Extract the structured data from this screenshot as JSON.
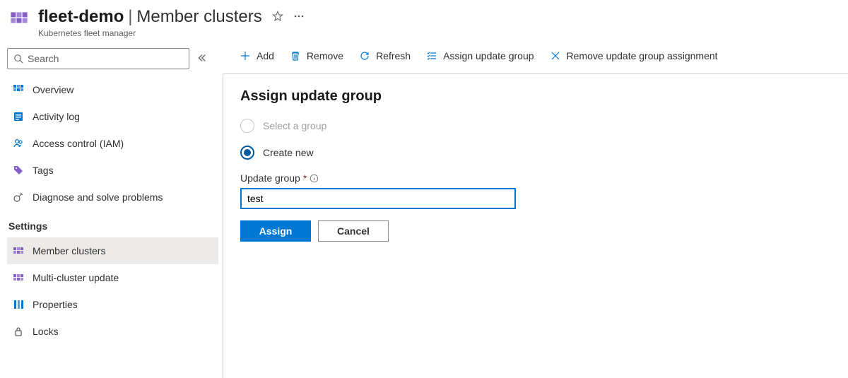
{
  "header": {
    "resource_name": "fleet-demo",
    "page_name": "Member clusters",
    "service_name": "Kubernetes fleet manager"
  },
  "sidebar": {
    "search_placeholder": "Search",
    "items": [
      {
        "icon": "overview",
        "label": "Overview"
      },
      {
        "icon": "activity",
        "label": "Activity log"
      },
      {
        "icon": "iam",
        "label": "Access control (IAM)"
      },
      {
        "icon": "tags",
        "label": "Tags"
      },
      {
        "icon": "diagnose",
        "label": "Diagnose and solve problems"
      }
    ],
    "settings_header": "Settings",
    "settings_items": [
      {
        "icon": "fleet-purple",
        "label": "Member clusters",
        "selected": true
      },
      {
        "icon": "fleet-purple",
        "label": "Multi-cluster update"
      },
      {
        "icon": "properties",
        "label": "Properties"
      },
      {
        "icon": "locks",
        "label": "Locks"
      }
    ]
  },
  "toolbar": {
    "add": "Add",
    "remove": "Remove",
    "refresh": "Refresh",
    "assign_group": "Assign update group",
    "remove_assignment": "Remove update group assignment"
  },
  "panel": {
    "title": "Assign update group",
    "radio_select": "Select a group",
    "radio_create": "Create new",
    "field_label": "Update group",
    "input_value": "test",
    "assign_btn": "Assign",
    "cancel_btn": "Cancel"
  }
}
